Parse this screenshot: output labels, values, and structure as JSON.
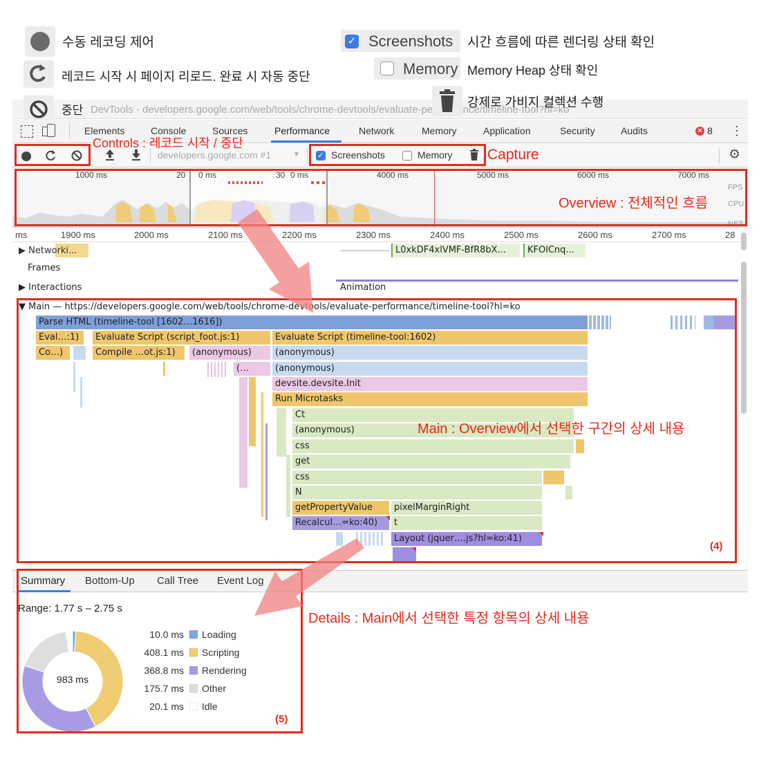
{
  "legend": {
    "record": "수동 레코딩 제어",
    "reload": "레코드 시작 시 페이지 리로드. 완료 시 자동 중단",
    "stop": "중단",
    "screenshots_label": "Screenshots",
    "screenshots_desc": "시간 흐름에 따른 렌더링 상태 확인",
    "memory_label": "Memory",
    "memory_desc": "Memory Heap 상태 확인",
    "gc": "강제로 가비지 컬렉션 수행"
  },
  "window": {
    "title": "DevTools - developers.google.com/web/tools/chrome-devtools/evaluate-performance/timeline-tool?hl=ko"
  },
  "tabs": [
    "Elements",
    "Console",
    "Sources",
    "Performance",
    "Network",
    "Memory",
    "Application",
    "Security",
    "Audits"
  ],
  "error_count": "8",
  "toolbar": {
    "url": "developers.google.com #1",
    "screenshots_label": "Screenshots",
    "memory_label": "Memory"
  },
  "annotations": {
    "controls": "Controls : 레코드 시작 / 중단",
    "capture": "Capture",
    "overview": "Overview : 전체적인 흐름",
    "main": "Main : Overview에서 선택한 구간의 상세 내용",
    "main_num": "(4)",
    "details": "Details : Main에서 선택한 특정 항목의 상세 내용",
    "details_num": "(5)"
  },
  "overview": {
    "ticks": [
      "1000 ms",
      "20",
      "0 ms",
      "30",
      "0 ms",
      "4000 ms",
      "5000 ms",
      "6000 ms",
      "7000 ms"
    ],
    "side_labels": [
      "FPS",
      "CPU",
      "NET"
    ]
  },
  "ruler": [
    "ms",
    "1900 ms",
    "2000 ms",
    "2100 ms",
    "2200 ms",
    "2300 ms",
    "2400 ms",
    "2500 ms",
    "2600 ms",
    "2700 ms",
    "28"
  ],
  "tracks": {
    "network": "Network",
    "network_suffix": "i...",
    "net_req1": "L0xkDF4xlVMF-BfR8bX...",
    "net_req2": "KFOlCnq...",
    "frames": "Frames",
    "interactions": "Interactions",
    "animation": "Animation",
    "main_title": "Main — https://developers.google.com/web/tools/chrome-devtools/evaluate-performance/timeline-tool?hl=ko"
  },
  "flame": {
    "parse_html": "Parse HTML (timeline-tool [1602…1616])",
    "eval_short": "Eval…:1)",
    "eval_foot": "Evaluate Script (script_foot.js:1)",
    "eval_timeline": "Evaluate Script (timeline-tool:1602)",
    "compile_short": "Co…)",
    "compile": "Compile …ot.js:1)",
    "anon1": "(anonymous)",
    "anon2": "(anonymous)",
    "anon3": "(…",
    "anon4": "(anonymous)",
    "devsite": "devsite.devsite.Init",
    "microtasks": "Run Microtasks",
    "ct": "Ct",
    "anon5": "(anonymous)",
    "css1": "css",
    "get": "get",
    "css2": "css",
    "n": "N",
    "getprop": "getPropertyValue",
    "pixel": "pixelMarginRight",
    "recalc": "Recalcul…=ko:40)",
    "t": "t",
    "layout": "Layout (jquer….js?hl=ko:41)"
  },
  "details": {
    "tabs": [
      "Summary",
      "Bottom-Up",
      "Call Tree",
      "Event Log"
    ],
    "range": "Range: 1.77 s – 2.75 s",
    "total": "983 ms",
    "rows": [
      {
        "value": "10.0 ms",
        "label": "Loading",
        "color": "#7ea6e0"
      },
      {
        "value": "408.1 ms",
        "label": "Scripting",
        "color": "#f0cc73"
      },
      {
        "value": "368.8 ms",
        "label": "Rendering",
        "color": "#a99ae6"
      },
      {
        "value": "175.7 ms",
        "label": "Other",
        "color": "#dedede"
      },
      {
        "value": "20.1 ms",
        "label": "Idle",
        "color": "#ffffff"
      }
    ]
  },
  "colors": {
    "annotation_red": "#e8271a",
    "loading": "#7ea6e0",
    "scripting": "#f0cc73",
    "rendering": "#a99ae6",
    "other": "#dedede",
    "idle": "#ffffff"
  }
}
